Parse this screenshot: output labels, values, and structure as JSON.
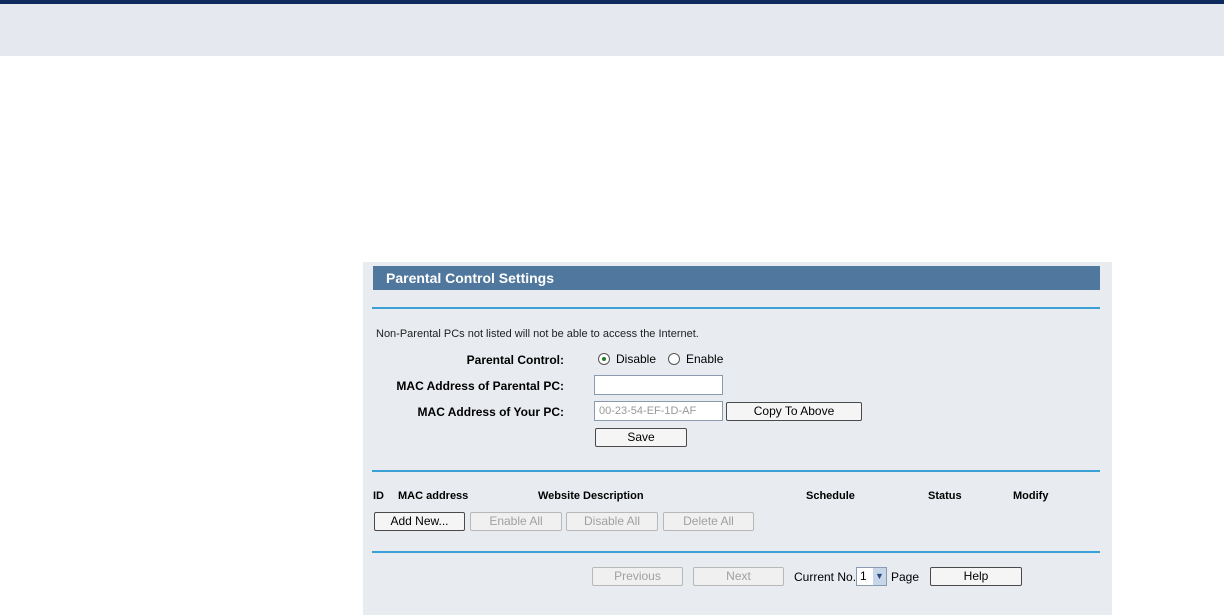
{
  "panel": {
    "title": "Parental Control Settings",
    "note": "Non-Parental PCs not listed will not be able to access the Internet."
  },
  "form": {
    "parental_control_label": "Parental Control:",
    "disable_label": "Disable",
    "enable_label": "Enable",
    "selected": "Disable",
    "mac_parental_label": "MAC Address of Parental PC:",
    "mac_parental_value": "",
    "mac_your_label": "MAC Address of Your PC:",
    "mac_your_value": "00-23-54-EF-1D-AF",
    "copy_button": "Copy To Above",
    "save_button": "Save"
  },
  "table": {
    "columns": [
      "ID",
      "MAC address",
      "Website Description",
      "Schedule",
      "Status",
      "Modify"
    ]
  },
  "actions": {
    "add_new": "Add New...",
    "enable_all": "Enable All",
    "disable_all": "Disable All",
    "delete_all": "Delete All"
  },
  "pager": {
    "previous": "Previous",
    "next": "Next",
    "current_no_label": "Current No.",
    "current_page": "1",
    "page_label": "Page",
    "help": "Help"
  },
  "colors": {
    "header_bg": "#50779d",
    "divider": "#3aa0d6",
    "panel_bg": "#e8ebf0",
    "top_bar": "#0f2a5c"
  }
}
